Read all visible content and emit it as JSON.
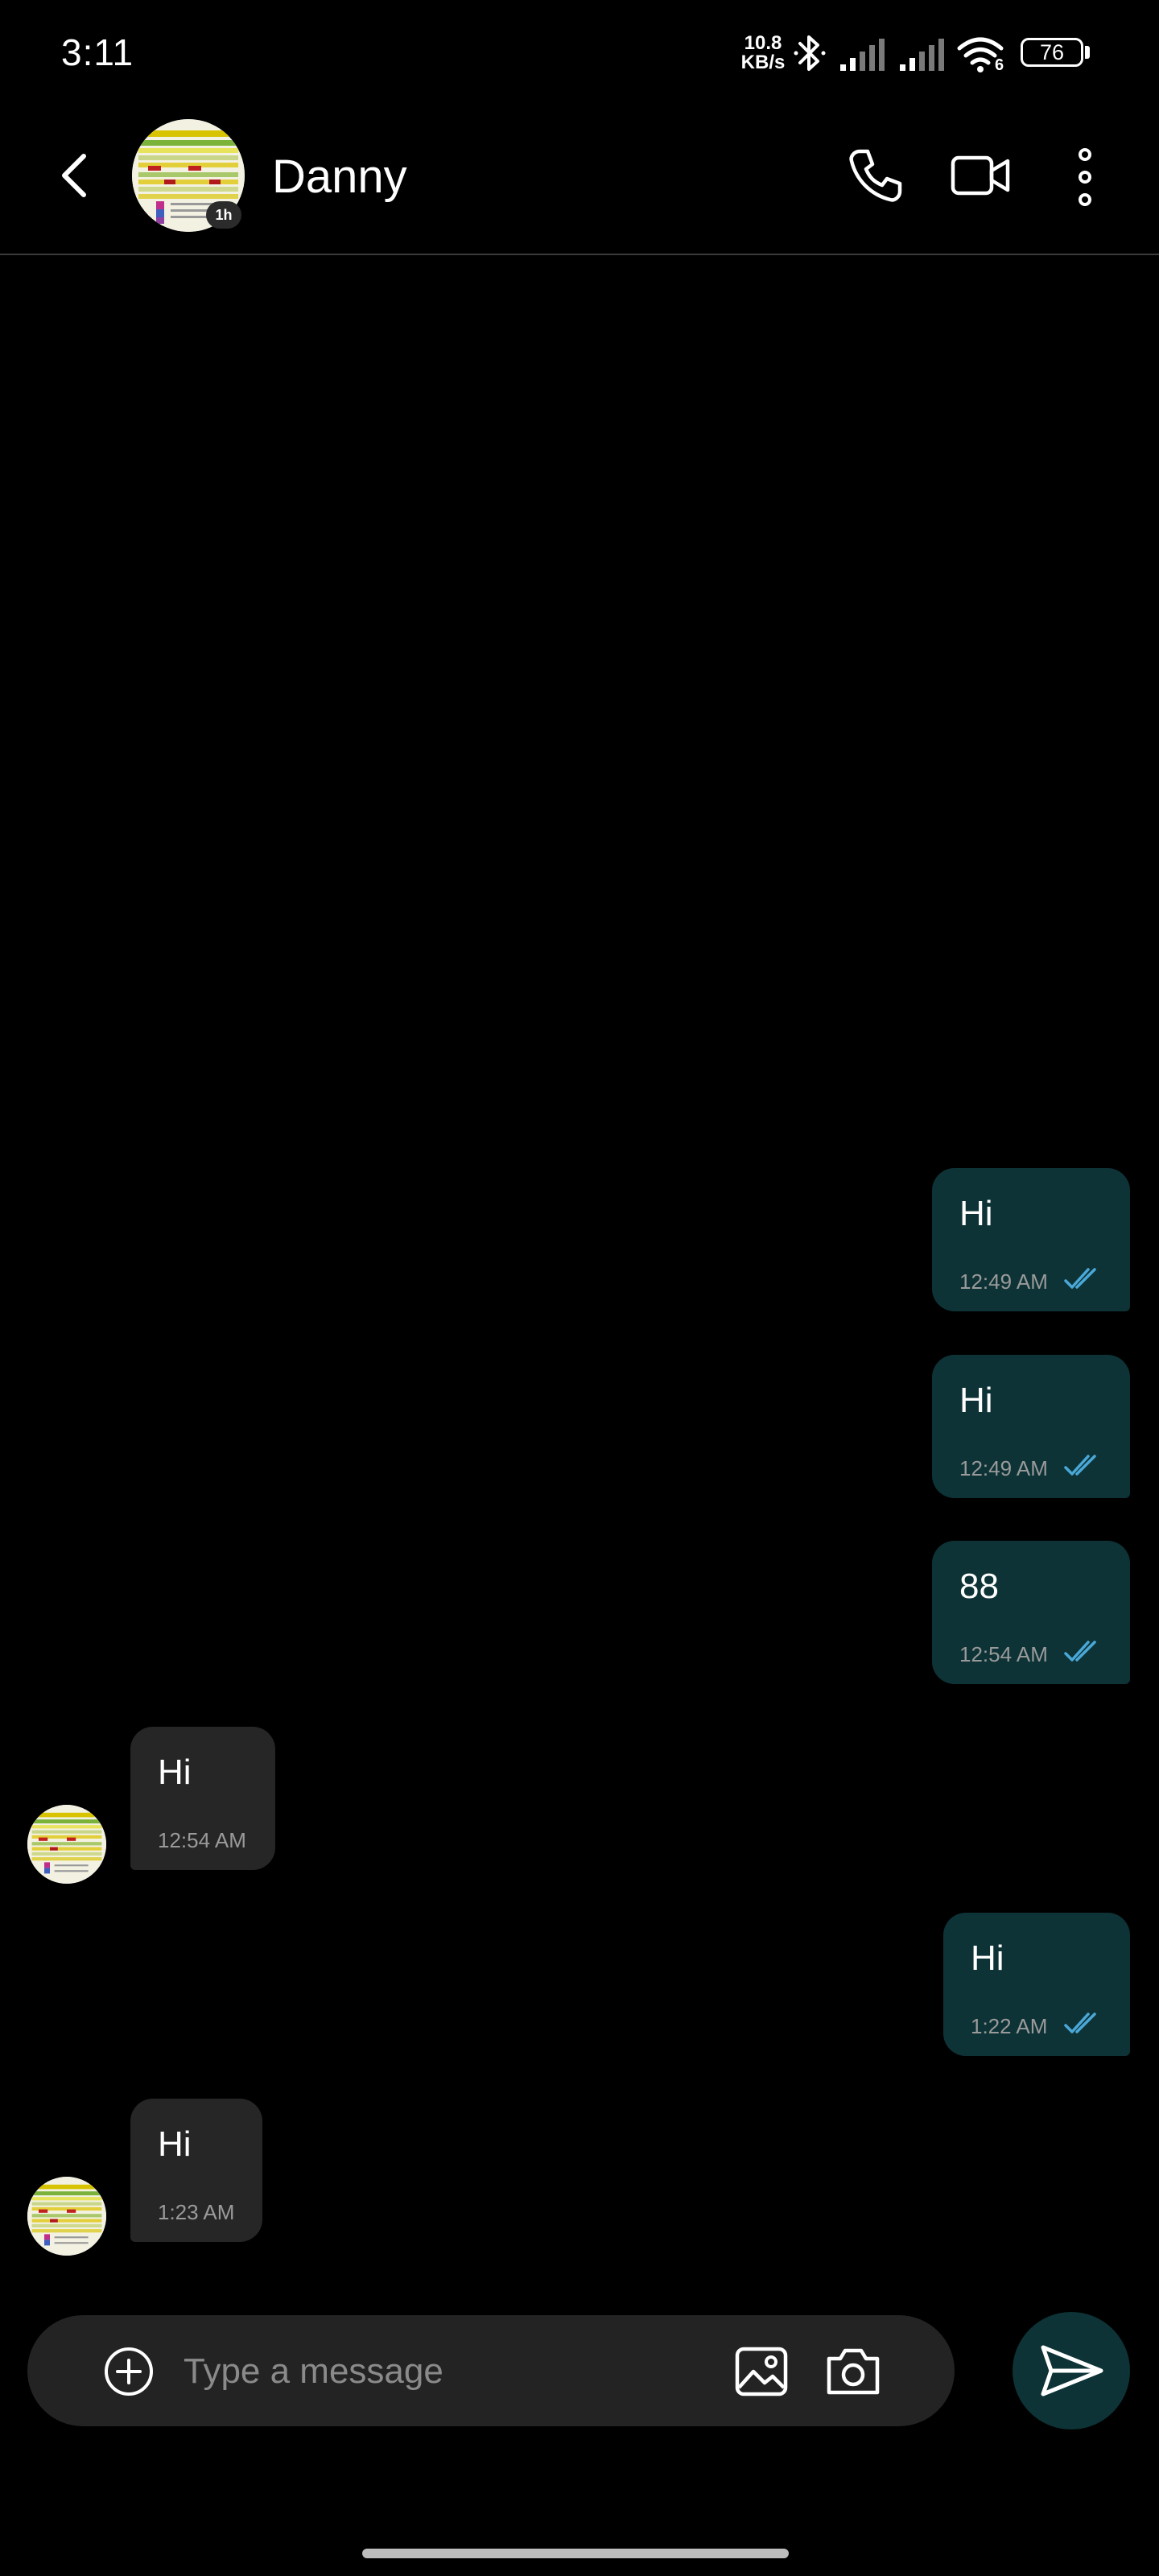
{
  "status_bar": {
    "time": "3:11",
    "net_speed_value": "10.8",
    "net_speed_unit": "KB/s",
    "wifi_label": "6",
    "battery": "76"
  },
  "header": {
    "contact_name": "Danny",
    "avatar_badge": "1h",
    "icons": [
      "back-arrow-icon",
      "phone-icon",
      "video-camera-icon",
      "more-vertical-icon"
    ]
  },
  "messages": [
    {
      "direction": "sent",
      "text": "Hi",
      "time": "12:49 AM",
      "read": true
    },
    {
      "direction": "sent",
      "text": "Hi",
      "time": "12:49 AM",
      "read": true
    },
    {
      "direction": "sent",
      "text": "88",
      "time": "12:54 AM",
      "read": true
    },
    {
      "direction": "received",
      "text": "Hi",
      "time": "12:54 AM"
    },
    {
      "direction": "sent",
      "text": "Hi",
      "time": "1:22 AM",
      "read": true
    },
    {
      "direction": "received",
      "text": "Hi",
      "time": "1:23 AM"
    }
  ],
  "composer": {
    "placeholder": "Type a message",
    "icons": [
      "add-circle-icon",
      "image-icon",
      "camera-icon",
      "send-icon"
    ]
  },
  "colors": {
    "background": "#000000",
    "sent_bubble": "#0d3336",
    "received_bubble": "#262626",
    "read_receipt": "#4aa8d8"
  }
}
